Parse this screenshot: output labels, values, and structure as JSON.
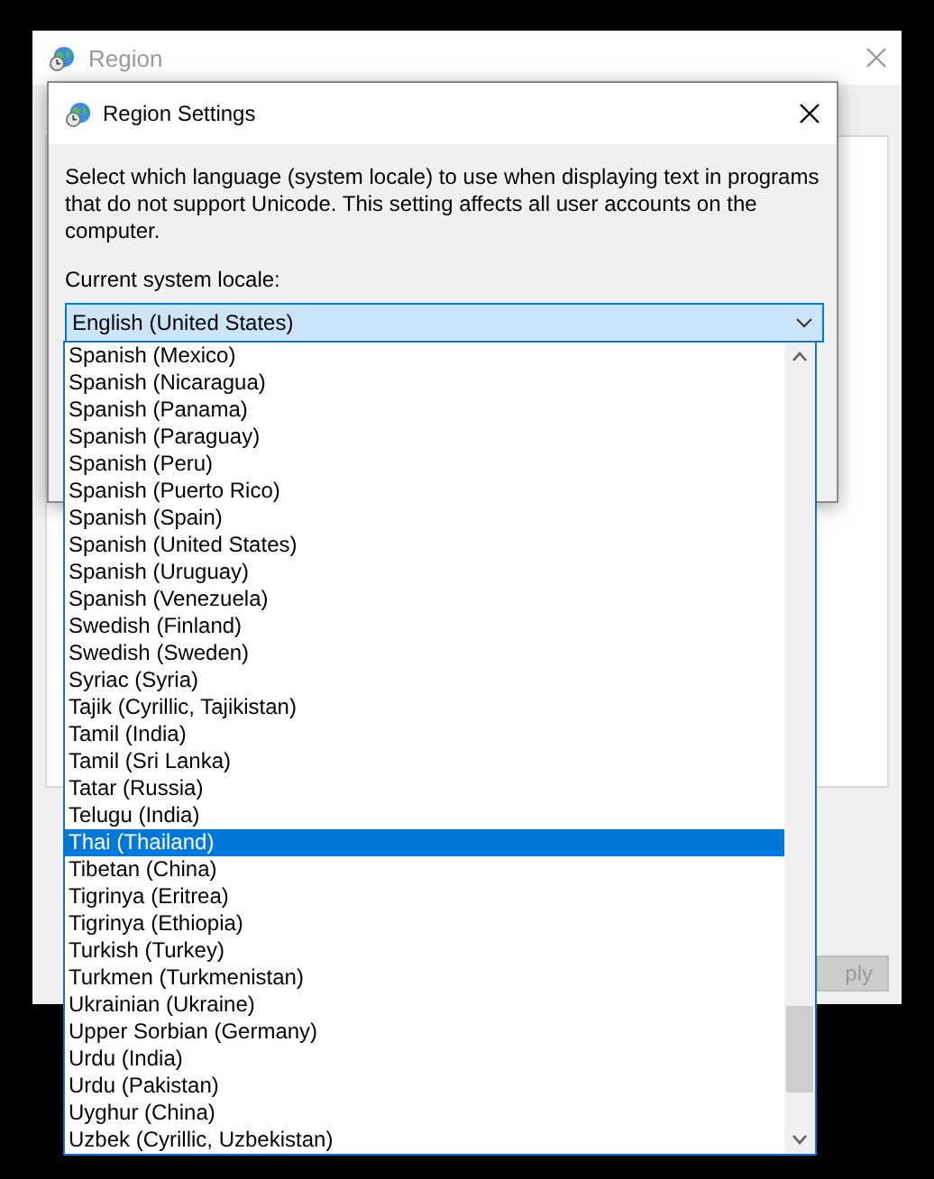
{
  "background_window": {
    "title": "Region",
    "button": "ply",
    "button_disabled": true
  },
  "dialog": {
    "title": "Region Settings",
    "description": "Select which language (system locale) to use when displaying text in programs that do not support Unicode. This setting affects all user accounts on the computer.",
    "locale_label": "Current system locale:",
    "locale_value": "English (United States)"
  },
  "locale_list": {
    "items": [
      {
        "label": "Spanish (Mexico)",
        "selected": false
      },
      {
        "label": "Spanish (Nicaragua)",
        "selected": false
      },
      {
        "label": "Spanish (Panama)",
        "selected": false
      },
      {
        "label": "Spanish (Paraguay)",
        "selected": false
      },
      {
        "label": "Spanish (Peru)",
        "selected": false
      },
      {
        "label": "Spanish (Puerto Rico)",
        "selected": false
      },
      {
        "label": "Spanish (Spain)",
        "selected": false
      },
      {
        "label": "Spanish (United States)",
        "selected": false
      },
      {
        "label": "Spanish (Uruguay)",
        "selected": false
      },
      {
        "label": "Spanish (Venezuela)",
        "selected": false
      },
      {
        "label": "Swedish (Finland)",
        "selected": false
      },
      {
        "label": "Swedish (Sweden)",
        "selected": false
      },
      {
        "label": "Syriac (Syria)",
        "selected": false
      },
      {
        "label": "Tajik (Cyrillic, Tajikistan)",
        "selected": false
      },
      {
        "label": "Tamil (India)",
        "selected": false
      },
      {
        "label": "Tamil (Sri Lanka)",
        "selected": false
      },
      {
        "label": "Tatar (Russia)",
        "selected": false
      },
      {
        "label": "Telugu (India)",
        "selected": false
      },
      {
        "label": "Thai (Thailand)",
        "selected": true
      },
      {
        "label": "Tibetan (China)",
        "selected": false
      },
      {
        "label": "Tigrinya (Eritrea)",
        "selected": false
      },
      {
        "label": "Tigrinya (Ethiopia)",
        "selected": false
      },
      {
        "label": "Turkish (Turkey)",
        "selected": false
      },
      {
        "label": "Turkmen (Turkmenistan)",
        "selected": false
      },
      {
        "label": "Ukrainian (Ukraine)",
        "selected": false
      },
      {
        "label": "Upper Sorbian (Germany)",
        "selected": false
      },
      {
        "label": "Urdu (India)",
        "selected": false
      },
      {
        "label": "Urdu (Pakistan)",
        "selected": false
      },
      {
        "label": "Uyghur (China)",
        "selected": false
      },
      {
        "label": "Uzbek (Cyrillic, Uzbekistan)",
        "selected": false
      }
    ]
  }
}
